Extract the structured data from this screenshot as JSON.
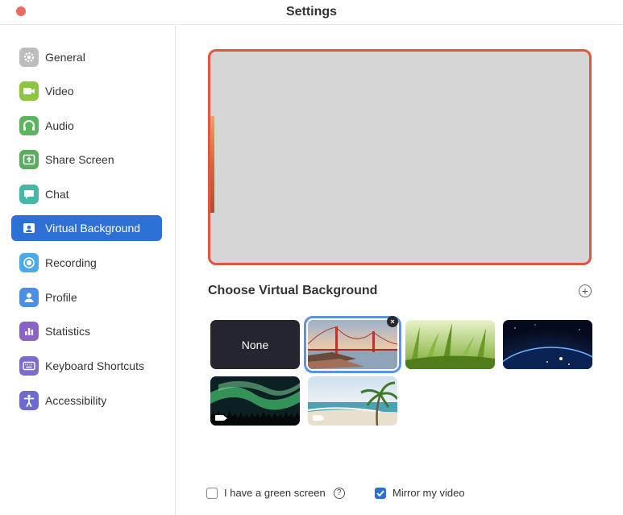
{
  "window": {
    "title": "Settings"
  },
  "sidebar": {
    "items": [
      {
        "label": "General",
        "icon": "gear-icon",
        "color": "#b9b9b9"
      },
      {
        "label": "Video",
        "icon": "video-camera-icon",
        "color": "#8cc63f"
      },
      {
        "label": "Audio",
        "icon": "headphones-icon",
        "color": "#5ab55e"
      },
      {
        "label": "Share Screen",
        "icon": "share-screen-icon",
        "color": "#5aad5e"
      },
      {
        "label": "Chat",
        "icon": "chat-bubble-icon",
        "color": "#43b8a8"
      },
      {
        "label": "Virtual Background",
        "icon": "user-card-icon",
        "color": "#2d71d7"
      },
      {
        "label": "Recording",
        "icon": "record-icon",
        "color": "#4aa9e6"
      },
      {
        "label": "Profile",
        "icon": "person-icon",
        "color": "#4a8ee6"
      },
      {
        "label": "Statistics",
        "icon": "bar-chart-icon",
        "color": "#8a63c7"
      },
      {
        "label": "Keyboard Shortcuts",
        "icon": "keyboard-icon",
        "color": "#7c6ccf"
      },
      {
        "label": "Accessibility",
        "icon": "accessibility-icon",
        "color": "#6a6ad0"
      }
    ],
    "active_index": 5
  },
  "main": {
    "choose_title": "Choose Virtual Background",
    "add_symbol": "+",
    "backgrounds": [
      {
        "label": "None",
        "kind": "none"
      },
      {
        "kind": "image",
        "subject": "golden-gate-bridge",
        "selected": true
      },
      {
        "kind": "image",
        "subject": "grass"
      },
      {
        "kind": "image",
        "subject": "earth-from-space"
      },
      {
        "kind": "video",
        "subject": "aurora"
      },
      {
        "kind": "video",
        "subject": "beach-palm"
      }
    ],
    "green_screen": {
      "label": "I have a green screen",
      "checked": false,
      "help": "?"
    },
    "mirror": {
      "label": "Mirror my video",
      "checked": true
    }
  }
}
